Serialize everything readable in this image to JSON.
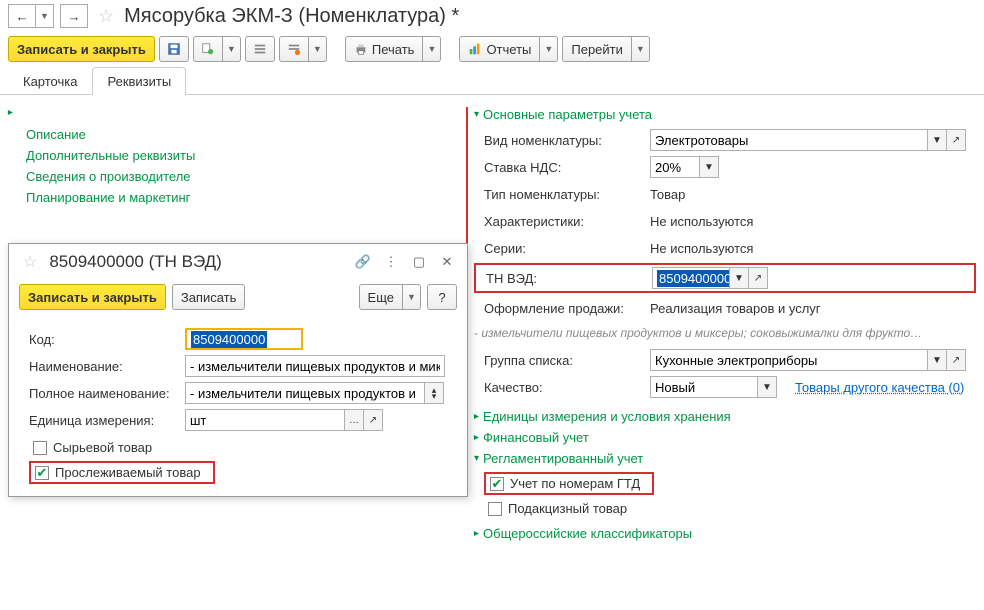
{
  "title": "Мясорубка ЭКМ-З (Номенклатура) *",
  "toolbar": {
    "save_close": "Записать и закрыть",
    "print": "Печать",
    "reports": "Отчеты",
    "goto": "Перейти"
  },
  "tabs": {
    "card": "Карточка",
    "props": "Реквизиты"
  },
  "left": {
    "desc": "Описание",
    "extra": "Дополнительные реквизиты",
    "manuf": "Сведения о производителе",
    "plan": "Планирование и маркетинг"
  },
  "right": {
    "main_params": "Основные параметры учета",
    "kind_label": "Вид номенклатуры:",
    "kind_val": "Электротовары",
    "vat_label": "Ставка НДС:",
    "vat_val": "20%",
    "type_label": "Тип номенклатуры:",
    "type_val": "Товар",
    "char_label": "Характеристики:",
    "char_val": "Не используются",
    "series_label": "Серии:",
    "series_val": "Не используются",
    "tnved_label": "ТН ВЭД:",
    "tnved_val": "8509400000",
    "sale_label": "Оформление продажи:",
    "sale_val": "Реализация товаров и услуг",
    "desc_line": "- измельчители пищевых продуктов и миксеры; соковыжималки для фрукто…",
    "group_label": "Группа списка:",
    "group_val": "Кухонные электроприборы",
    "quality_label": "Качество:",
    "quality_val": "Новый",
    "other_quality": "Товары другого качества (0)",
    "units": "Единицы измерения и условия хранения",
    "fin": "Финансовый учет",
    "reg": "Регламентированный учет",
    "gtd": "Учет по номерам ГТД",
    "excise": "Подакцизный товар",
    "classif": "Общероссийские классификаторы"
  },
  "dialog": {
    "title": "8509400000 (ТН ВЭД)",
    "save_close": "Записать и закрыть",
    "save": "Записать",
    "more": "Еще",
    "code_label": "Код:",
    "code_val": "8509400000",
    "name_label": "Наименование:",
    "name_val": "- измельчители пищевых продуктов и миксерь",
    "fullname_label": "Полное наименование:",
    "fullname_val": "- измельчители пищевых продуктов и",
    "unit_label": "Единица измерения:",
    "unit_val": "шт",
    "raw": "Сырьевой товар",
    "trace": "Прослеживаемый товар"
  }
}
